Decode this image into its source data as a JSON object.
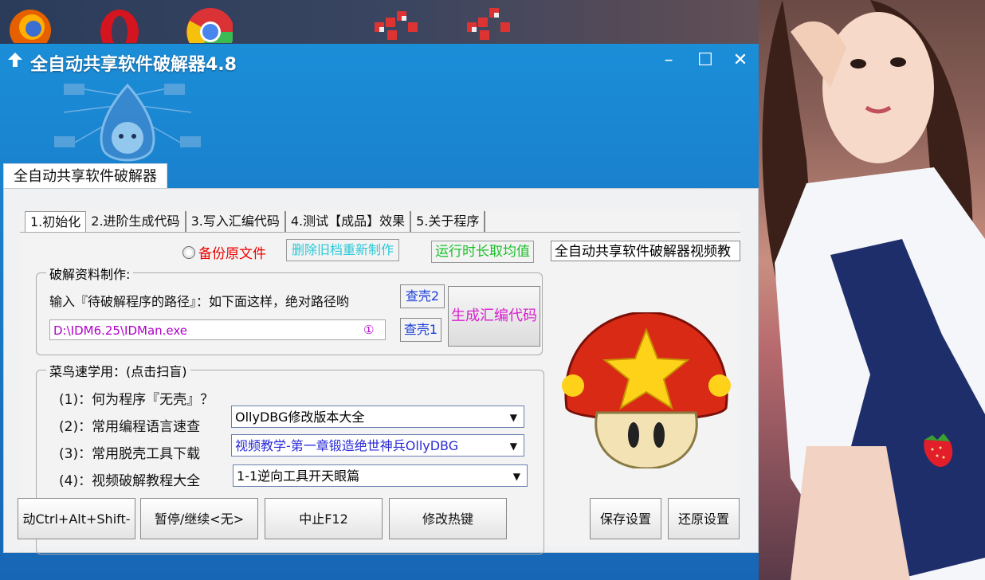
{
  "window": {
    "title": "全自动共享软件破解器4.8",
    "minimize": "–",
    "maximize": "☐",
    "close": "✕"
  },
  "outer_tab": "全自动共享软件破解器",
  "tabs": [
    {
      "label": "1.初始化",
      "active": true
    },
    {
      "label": "2.进阶生成代码",
      "active": false
    },
    {
      "label": "3.写入汇编代码",
      "active": false
    },
    {
      "label": "4.测试【成品】效果",
      "active": false
    },
    {
      "label": "5.关于程序",
      "active": false
    }
  ],
  "init": {
    "backup_radio": "备份原文件",
    "delete_rebuild_button": "删除旧档重新制作",
    "runtime_average_button": "运行时长取均值",
    "video_field": "全自动共享软件破解器视频教",
    "crack_group_title": "破解资料制作:",
    "path_hint": "输入『待破解程序的路径』：如下面这样，绝对路径哟",
    "path_value": "D:\\IDM6.25\\IDMan.exe",
    "path_marker": "①",
    "check_shell2": "查壳2",
    "check_shell1": "查壳1",
    "generate_button": "生成汇编代码",
    "learn_group_title": "菜鸟速学用：(点击扫盲)",
    "questions": [
      {
        "label": "(1)：何为程序『无壳』？",
        "dropdown": "OllyDBG修改版本大全"
      },
      {
        "label": "(2)：常用编程语言速查",
        "dropdown": "视频教学-第一章锻造绝世神兵OllyDBG"
      },
      {
        "label": "(3)：常用脱壳工具下载",
        "dropdown": "1-1逆向工具开天眼篇"
      },
      {
        "label": "(4)：视频破解教程大全",
        "dropdown": ""
      }
    ]
  },
  "bottom_buttons": {
    "start": "动Ctrl+Alt+Shift-",
    "pause": "暂停/继续<无>",
    "stop": "中止F12",
    "hotkey": "修改热键",
    "save": "保存设置",
    "restore": "还原设置"
  },
  "colors": {
    "title_bar": "#1b8ed8",
    "radio_label": "#ee0000",
    "cyan_button": "#28c9d8",
    "green_button": "#1bbf2a",
    "shell_button": "#1a3fd8",
    "generate_button": "#d820d0",
    "path_text": "#b000c8"
  }
}
